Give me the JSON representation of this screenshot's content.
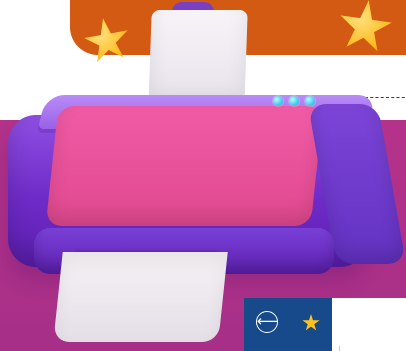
{
  "ui": {
    "accent": "#174a8a",
    "magenta": "#b5328a",
    "orange": "#d35a12",
    "printer_purple": "#7b3fc1",
    "printer_pink": "#e0498f",
    "star_yellow": "#ffbf2a",
    "button_cyan": "#41cfe8"
  },
  "icons": {
    "back": "arrow-left-icon",
    "favorite": "star-icon"
  }
}
